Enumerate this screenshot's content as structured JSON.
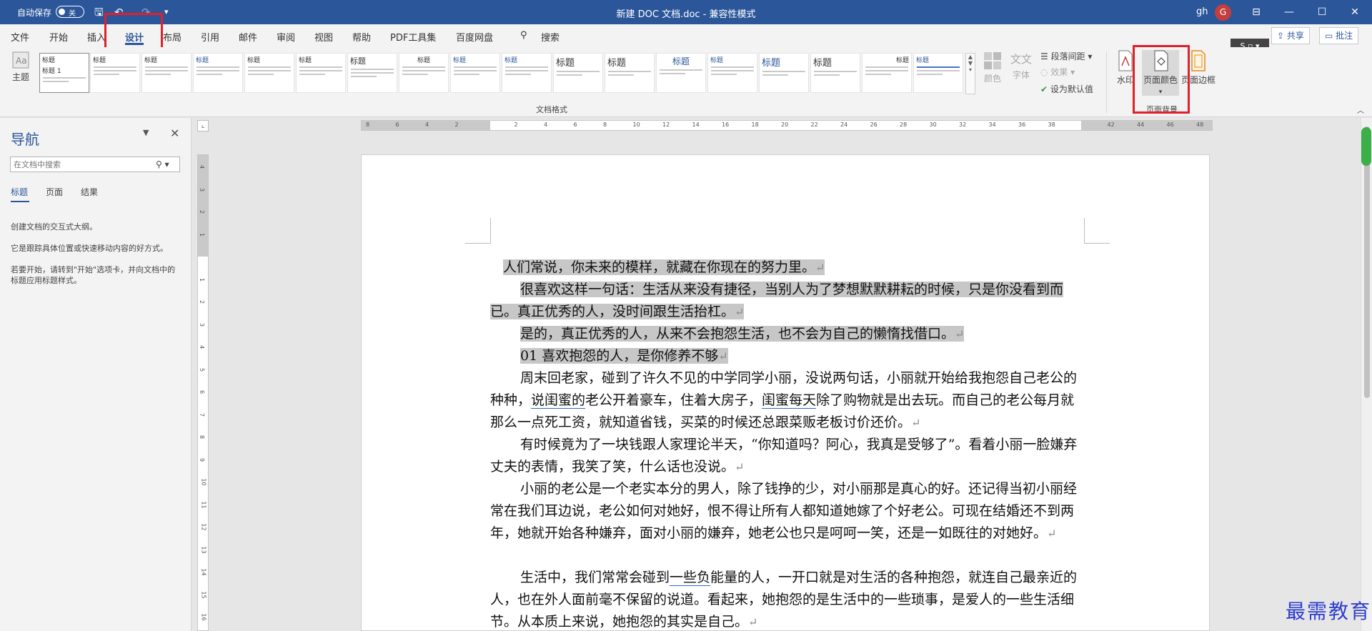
{
  "titlebar": {
    "autosave_label": "自动保存",
    "autosave_state": "关",
    "doc_title": "新建 DOC 文档.doc  -  兼容性模式",
    "user_initials": "gh",
    "avatar_letter": "G"
  },
  "tabs": [
    "文件",
    "开始",
    "插入",
    "设计",
    "布局",
    "引用",
    "邮件",
    "审阅",
    "视图",
    "帮助",
    "PDF工具集",
    "百度网盘"
  ],
  "active_tab": "设计",
  "search_tab": "搜索",
  "share_label": "共享",
  "comment_label": "批注",
  "ribbon": {
    "theme_label": "主题",
    "gallery_group_label": "文档格式",
    "colors_label": "颜色",
    "fonts_label": "字体",
    "paragraph_spacing": "段落间距",
    "effects": "效果",
    "set_default": "设为默认值",
    "watermark": "水印",
    "page_color": "页面颜色",
    "page_border": "页面边框",
    "page_background_group": "页面背景",
    "gallery_heading": "标题",
    "gallery_first_title": "标题 1"
  },
  "nav": {
    "title": "导航",
    "search_placeholder": "在文档中搜索",
    "tab_headings": "标题",
    "tab_pages": "页面",
    "tab_results": "结果",
    "text1": "创建文档的交互式大纲。",
    "text2": "它是跟踪具体位置或快速移动内容的好方式。",
    "text3": "若要开始，请转到\"开始\"选项卡，并向文档中的标题应用标题样式。"
  },
  "document": {
    "p1": "人们常说，你未来的模样，就藏在你现在的努力里。",
    "p2": "很喜欢这样一句话：生活从来没有捷径，当别人为了梦想默默耕耘的时候，只是你没看到而已。真正优秀的人，没时间跟生活抬杠。",
    "p3": "是的，真正优秀的人，从来不会抱怨生活，也不会为自己的懒惰找借口。",
    "p4": "01  喜欢抱怨的人，是你修养不够",
    "p5a": "周末回老家，碰到了许久不见的中学同学小丽，没说两句话，小丽就开始给我抱怨自己老公的种种，",
    "p5b": "说闺蜜的",
    "p5c": "老公开着豪车，住着大房子，",
    "p5d": "闺蜜每天",
    "p5e": "除了购物就是出去玩。而自己的老公每月就那么一点死工资，就知道省钱，买菜的时候还总跟菜贩老板讨价还价。",
    "p6": "有时候竟为了一块钱跟人家理论半天，“你知道吗？阿心，我真是受够了”。看着小丽一脸嫌弃丈夫的表情，我笑了笑，什么话也没说。",
    "p7": "小丽的老公是一个老实本分的男人，除了钱挣的少，对小丽那是真心的好。还记得当初小丽经常在我们耳边说，老公如何对她好，恨不得让所有人都知道她嫁了个好老公。可现在结婚还不到两年，她就开始各种嫌弃，面对小丽的嫌弃，她老公也只是呵呵一笑，还是一如既往的对她好。",
    "p8a": "生活中，我们常常会碰到",
    "p8b": "一些负",
    "p8c": "能量的人，一开口就是对生活的各种抱怨，就连自己最亲近的人，也在外人面前毫不保留的说道。看起来，她抱怨的是生活中的一些琐事，是爱人的一些生活细节。从本质上来说，她抱怨的其实是自己。",
    "pmark": "↵"
  },
  "ruler_numbers_h": [
    "8",
    "6",
    "4",
    "2",
    "",
    "2",
    "4",
    "6",
    "8",
    "10",
    "12",
    "14",
    "16",
    "18",
    "20",
    "22",
    "24",
    "26",
    "28",
    "30",
    "32",
    "34",
    "36",
    "38",
    "",
    "42",
    "44",
    "46",
    "48"
  ],
  "ruler_numbers_v": [
    "4",
    "3",
    "2",
    "1",
    "",
    "1",
    "2",
    "3",
    "4",
    "5",
    "6",
    "7",
    "8",
    "9",
    "10",
    "11",
    "12",
    "13",
    "14",
    "15",
    "16"
  ],
  "watermark_text": "最需教育",
  "sogou_label": "S",
  "colors": {
    "brand": "#2b579a",
    "highlight": "#c7c7c7",
    "redbox": "#e0202a"
  }
}
